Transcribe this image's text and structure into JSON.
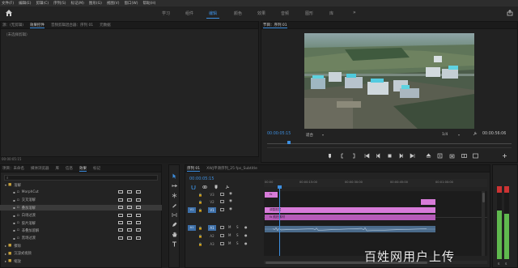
{
  "menu": [
    "文件(F)",
    "编辑(E)",
    "剪辑(C)",
    "序列(S)",
    "标记(M)",
    "图形(G)",
    "视图(V)",
    "窗口(W)",
    "帮助(H)"
  ],
  "workspaces": [
    "学习",
    "组件",
    "编辑",
    "颜色",
    "效果",
    "音频",
    "图形",
    "库"
  ],
  "workspace_active": "编辑",
  "source_panel": {
    "tabs": [
      "源：(无剪辑)",
      "效果控件",
      "音频剪辑混合器：序列 01",
      "元数据"
    ],
    "active_tab": "效果控件",
    "empty_label": "（未选择剪辑）"
  },
  "program_panel": {
    "title": "节目：序列 01",
    "timecode": "00:00:05:15",
    "fit": "适合",
    "ratio": "1/4",
    "duration": "00:00:56:06"
  },
  "effects_panel": {
    "tabs": [
      "项目：未命名",
      "媒体浏览器",
      "库",
      "信息",
      "效果",
      "标记"
    ],
    "active_tab": "效果",
    "items": [
      {
        "label": "溶解",
        "depth": 0,
        "expanded": true
      },
      {
        "label": "MorphCut",
        "depth": 1
      },
      {
        "label": "交叉溶解",
        "depth": 1
      },
      {
        "label": "叠加溶解",
        "depth": 1,
        "selected": true
      },
      {
        "label": "白场过渡",
        "depth": 1
      },
      {
        "label": "胶片溶解",
        "depth": 1
      },
      {
        "label": "非叠加溶解",
        "depth": 1
      },
      {
        "label": "黑场过渡",
        "depth": 1
      },
      {
        "label": "擦除",
        "depth": 0
      },
      {
        "label": "沉浸式视频",
        "depth": 0
      },
      {
        "label": "缩放",
        "depth": 0
      }
    ]
  },
  "timeline": {
    "tabs": [
      "序列 01",
      "XWJ平滑序列_25 fps_Subtitle"
    ],
    "active_tab": "序列 01",
    "timecode": "00:00:05:15",
    "ruler": [
      "00:00",
      "00:00:15:00",
      "00:00:30:00",
      "00:00:45:00",
      "00:01:00:00"
    ],
    "tracks": [
      "V3",
      "V2",
      "V1",
      "A1",
      "A2",
      "A3"
    ],
    "source_patch": [
      "V1",
      "A1"
    ],
    "track_buttons": [
      "M",
      "S"
    ],
    "clips": {
      "v3_a": "fx",
      "v2_title": "调整图层",
      "v1_main": "fx 航拍素材"
    }
  },
  "meter_labels": [
    "S",
    "S"
  ],
  "watermark": "百姓网用户上传",
  "colors": {
    "accent": "#3d8fe0",
    "clip_pink": "#d77bd9",
    "clip_pink_dark": "#b65bb9",
    "audio_clip": "#4a6a8a",
    "meter_green": "#5fb94e"
  }
}
